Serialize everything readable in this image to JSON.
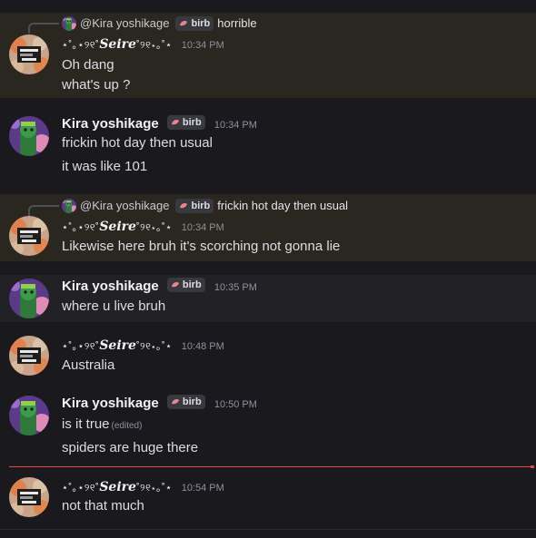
{
  "users": {
    "seire": {
      "display_name": "Seire",
      "prefix": "⋆˚｡⋆୨୧˚",
      "suffix": "˚୨୧⋆｡˚⋆"
    },
    "kira": {
      "display_name": "Kira yoshikage",
      "mention": "@Kira yoshikage",
      "tag": "birb"
    }
  },
  "messages": [
    {
      "reply_to": "horrible",
      "time": "10:34 PM",
      "lines": [
        "Oh dang",
        "what's up ?"
      ]
    },
    {
      "time": "10:34 PM",
      "lines": [
        "frickin hot day then usual",
        "it was like 101"
      ]
    },
    {
      "reply_to": "frickin hot day then usual",
      "time": "10:34 PM",
      "lines": [
        "Likewise here bruh it's scorching not gonna lie"
      ]
    },
    {
      "time": "10:35 PM",
      "lines": [
        "where u live bruh"
      ]
    },
    {
      "time": "10:48 PM",
      "lines": [
        "Australia"
      ]
    },
    {
      "time": "10:50 PM",
      "lines": [
        "is it true",
        "spiders are huge there"
      ],
      "edited_label": "(edited)"
    },
    {
      "time": "10:54 PM",
      "lines": [
        "not that much"
      ]
    }
  ],
  "colors": {
    "mention_highlight": "#2a2620",
    "new_divider": "#e64545",
    "tag_icon": "#e8868a"
  }
}
